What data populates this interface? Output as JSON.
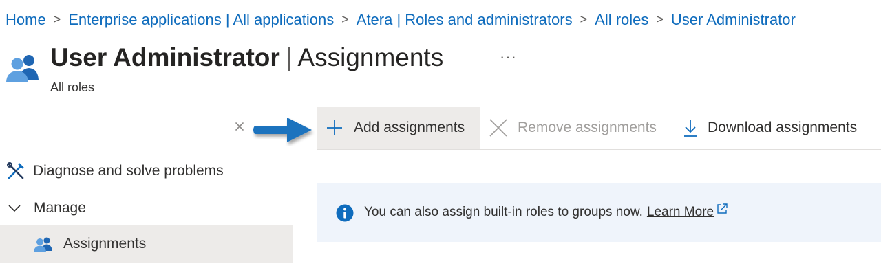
{
  "breadcrumb": {
    "items": [
      {
        "label": "Home"
      },
      {
        "label": "Enterprise applications | All applications"
      },
      {
        "label": "Atera | Roles and administrators"
      },
      {
        "label": "All roles"
      },
      {
        "label": "User Administrator"
      }
    ]
  },
  "header": {
    "title": "User Administrator",
    "divider": "|",
    "section": "Assignments",
    "more": "···",
    "subtitle": "All roles"
  },
  "toolbar": {
    "add_label": "Add assignments",
    "remove_label": "Remove assignments",
    "download_label": "Download assignments"
  },
  "sidebar": {
    "items": [
      {
        "label": "Diagnose and solve problems",
        "icon": "wrench-screwdriver-icon"
      },
      {
        "label": "Manage",
        "icon": "chevron-down-icon"
      },
      {
        "label": "Assignments",
        "icon": "users-icon",
        "selected": true
      }
    ]
  },
  "banner": {
    "text": "You can also assign built-in roles to groups now.",
    "link": "Learn More"
  },
  "colors": {
    "accent": "#0f6cbd",
    "selected_bg": "#edebe9",
    "banner_bg": "#eff4fb",
    "info_icon": "#0f6cbd",
    "arrow": "#1e73be"
  }
}
